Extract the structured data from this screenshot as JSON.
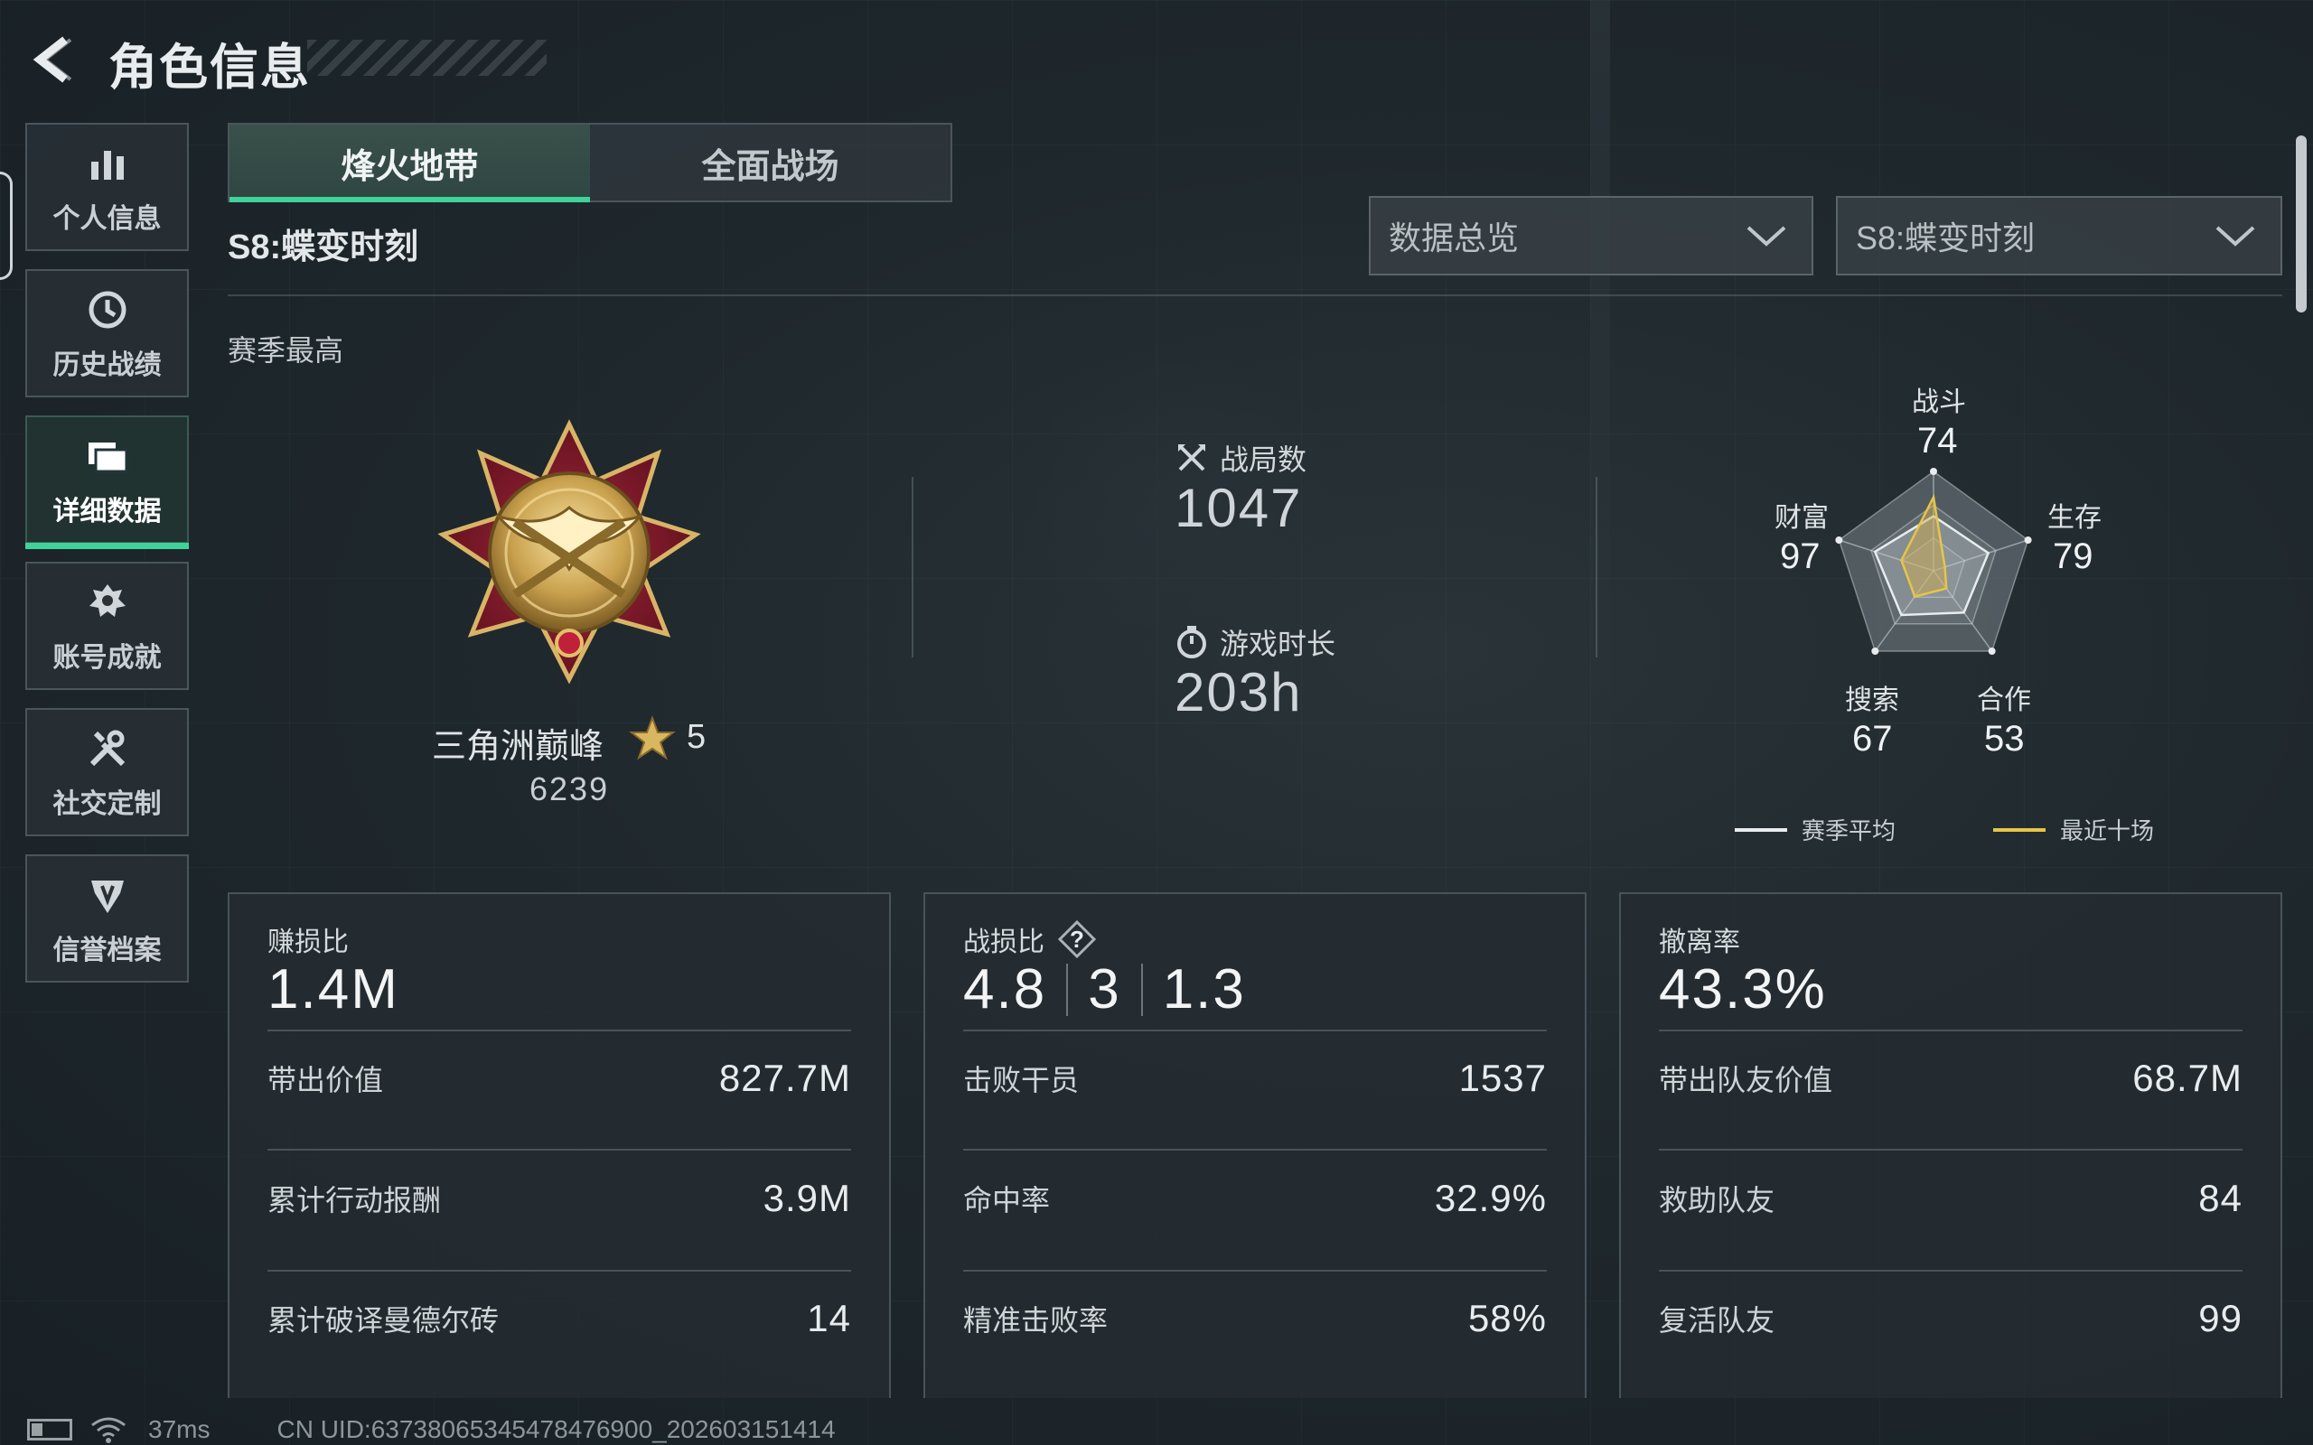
{
  "header": {
    "title": "角色信息"
  },
  "sidebar": {
    "items": [
      {
        "label": "个人信息",
        "icon": "bar-chart-icon",
        "active": false
      },
      {
        "label": "历史战绩",
        "icon": "history-clock-icon",
        "active": false
      },
      {
        "label": "详细数据",
        "icon": "folder-data-icon",
        "active": true
      },
      {
        "label": "账号成就",
        "icon": "achievement-medal-icon",
        "active": false
      },
      {
        "label": "社交定制",
        "icon": "tools-wrench-icon",
        "active": false
      },
      {
        "label": "信誉档案",
        "icon": "reputation-shield-icon",
        "active": false
      }
    ]
  },
  "tabs": [
    {
      "label": "烽火地带",
      "active": true
    },
    {
      "label": "全面战场",
      "active": false
    }
  ],
  "season_title": "S8:蝶变时刻",
  "filters": {
    "data_view": "数据总览",
    "season": "S8:蝶变时刻"
  },
  "season_high": {
    "label": "赛季最高",
    "rank_name": "三角洲巅峰",
    "stars": "5",
    "score": "6239"
  },
  "summary": {
    "matches_label": "战局数",
    "matches_value": "1047",
    "playtime_label": "游戏时长",
    "playtime_value": "203h"
  },
  "radar": {
    "axes": [
      {
        "label": "战斗",
        "value": "74"
      },
      {
        "label": "生存",
        "value": "79"
      },
      {
        "label": "合作",
        "value": "53"
      },
      {
        "label": "搜索",
        "value": "67"
      },
      {
        "label": "财富",
        "value": "97"
      }
    ],
    "season_avg": [
      0.55,
      0.58,
      0.52,
      0.55,
      0.62
    ],
    "recent10": [
      0.74,
      0.12,
      0.22,
      0.32,
      0.34
    ],
    "legend": {
      "season_avg": "赛季平均",
      "recent10": "最近十场"
    },
    "colors": {
      "season_avg": "#e8ecee",
      "recent10": "#e6c54a"
    }
  },
  "cards": [
    {
      "head_label": "赚损比",
      "head_value": "1.4M",
      "rows": [
        {
          "k": "带出价值",
          "v": "827.7M"
        },
        {
          "k": "累计行动报酬",
          "v": "3.9M"
        },
        {
          "k": "累计破译曼德尔砖",
          "v": "14"
        }
      ]
    },
    {
      "head_label": "战损比",
      "head_values": [
        "4.8",
        "3",
        "1.3"
      ],
      "help": "?",
      "rows": [
        {
          "k": "击败干员",
          "v": "1537"
        },
        {
          "k": "命中率",
          "v": "32.9%"
        },
        {
          "k": "精准击败率",
          "v": "58%"
        }
      ]
    },
    {
      "head_label": "撤离率",
      "head_value": "43.3%",
      "rows": [
        {
          "k": "带出队友价值",
          "v": "68.7M"
        },
        {
          "k": "救助队友",
          "v": "84"
        },
        {
          "k": "复活队友",
          "v": "99"
        }
      ]
    }
  ],
  "statusbar": {
    "ping": "37ms",
    "uid": "CN UID:6373806534547847690​0_202603151414"
  },
  "colors": {
    "accent": "#3fd39a",
    "gold": "#e6c54a"
  }
}
